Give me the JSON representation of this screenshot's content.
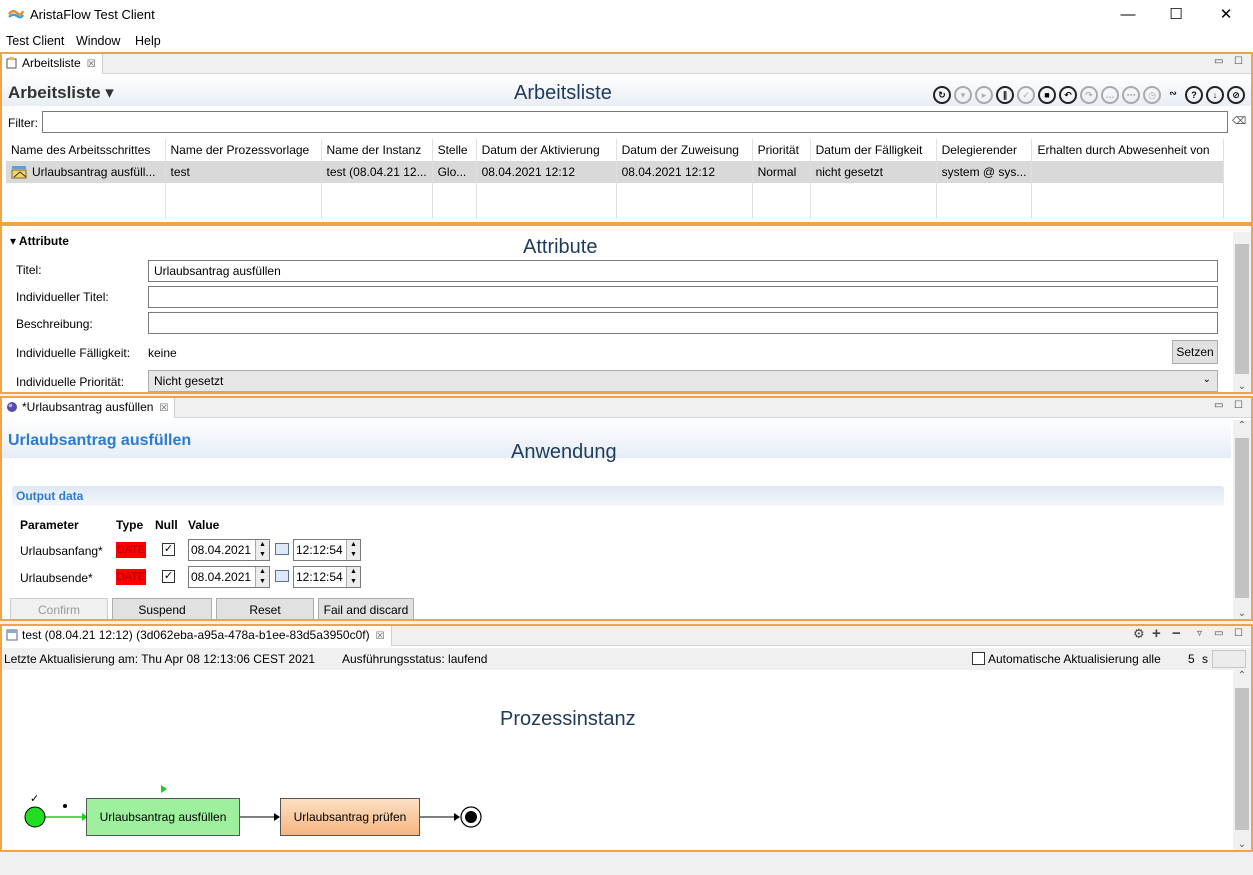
{
  "window": {
    "title": "AristaFlow Test Client",
    "minimize": "—",
    "maximize": "☐",
    "close": "✕"
  },
  "menu": [
    "Test Client",
    "Window",
    "Help"
  ],
  "worklist": {
    "tab_label": "Arbeitsliste",
    "header_title": "Arbeitsliste ▾",
    "overlay": "Arbeitsliste",
    "filter_label": "Filter:",
    "filter_value": "",
    "columns": [
      "Name des Arbeitsschrittes",
      "Name der Prozessvorlage",
      "Name der Instanz",
      "Stelle",
      "Datum der Aktivierung",
      "Datum der Zuweisung",
      "Priorität",
      "Datum der Fälligkeit",
      "Delegierender",
      "Erhalten durch Abwesenheit von"
    ],
    "rows": [
      [
        "Urlaubsantrag ausfüll...",
        "test",
        "test (08.04.21 12...",
        "Glo...",
        "08.04.2021 12:12",
        "08.04.2021 12:12",
        "Normal",
        "nicht gesetzt",
        "system @ sys...",
        ""
      ]
    ],
    "toolbar_icons": [
      "refresh-icon",
      "down-icon",
      "play-icon",
      "pause-icon",
      "check-icon",
      "stop-icon",
      "undo-icon",
      "redo-icon",
      "comment-icon",
      "chat-icon",
      "timer-icon",
      "graph-icon",
      "help-icon",
      "download-icon",
      "cancel-icon"
    ]
  },
  "attributes": {
    "overlay": "Attribute",
    "section_title": "Attribute",
    "title_label": "Titel:",
    "title_value": "Urlaubsantrag ausfüllen",
    "ind_title_label": "Individueller Titel:",
    "ind_title_value": "",
    "description_label": "Beschreibung:",
    "description_value": "",
    "due_label": "Individuelle Fälligkeit:",
    "due_value": "keine",
    "set_button": "Setzen",
    "priority_label": "Individuelle Priorität:",
    "priority_value": "Nicht gesetzt"
  },
  "application": {
    "tab_label": "*Urlaubsantrag ausfüllen",
    "header_title": "Urlaubsantrag ausfüllen",
    "overlay": "Anwendung",
    "section_title": "Output data",
    "col_parameter": "Parameter",
    "col_type": "Type",
    "col_null": "Null",
    "col_value": "Value",
    "params": [
      {
        "name": "Urlaubsanfang*",
        "type": "DATE",
        "null_checked": "✓",
        "date": "08.04.2021",
        "time": "12:12:54"
      },
      {
        "name": "Urlaubsende*",
        "type": "DATE",
        "null_checked": "✓",
        "date": "08.04.2021",
        "time": "12:12:54"
      }
    ],
    "buttons": {
      "confirm": "Confirm",
      "suspend": "Suspend",
      "reset": "Reset",
      "fail": "Fail and discard"
    }
  },
  "process": {
    "tab_label": "test (08.04.21 12:12) (3d062eba-a95a-478a-b1ee-83d5a3950c0f)",
    "last_update": "Letzte Aktualisierung am: Thu Apr 08 12:13:06 CEST 2021",
    "status": "Ausführungsstatus: laufend",
    "auto_update_label": "Automatische Aktualisierung alle",
    "auto_update_value": "5",
    "auto_update_unit": "s",
    "overlay": "Prozessinstanz",
    "node_1": "Urlaubsantrag ausfüllen",
    "node_2": "Urlaubsantrag prüfen",
    "start_mark": "✓",
    "colors": {
      "start": "#22dd22",
      "active": "#9ef09e",
      "pending": "#f8c08c"
    }
  }
}
